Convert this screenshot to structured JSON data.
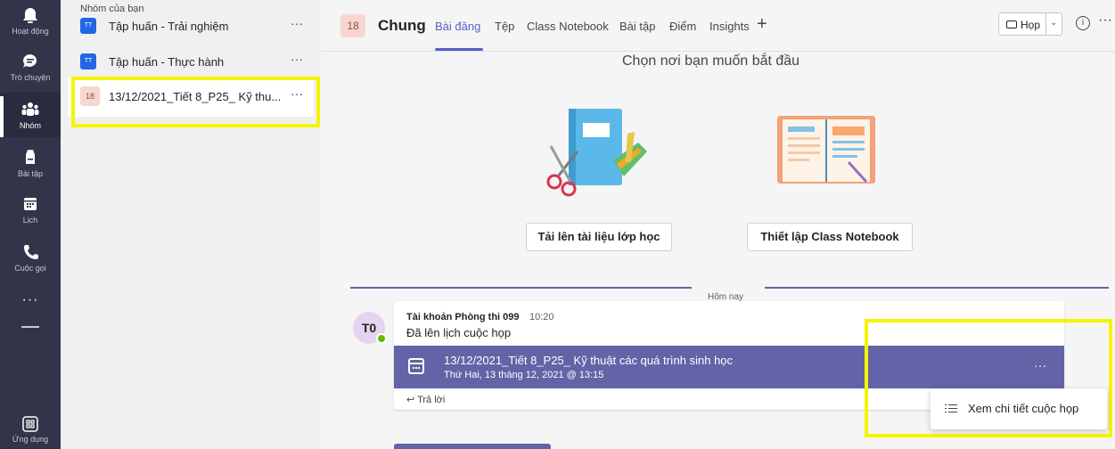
{
  "rail": {
    "items": [
      {
        "label": "Hoạt động"
      },
      {
        "label": "Trò chuyện"
      },
      {
        "label": "Nhóm"
      },
      {
        "label": "Bài tập"
      },
      {
        "label": "Lịch"
      },
      {
        "label": "Cuộc gọi"
      }
    ],
    "more": "···",
    "apps": "Ứng dụng"
  },
  "teams": {
    "header": "Nhóm của bạn",
    "list": [
      {
        "badge": "TT",
        "name": "Tập huấn - Trải nghiệm",
        "more": "···"
      },
      {
        "badge": "TT",
        "name": "Tập huấn - Thực hành",
        "more": "···"
      },
      {
        "badge": "18",
        "name": "13/12/2021_Tiết 8_P25_ Kỹ thu...",
        "more": "···"
      }
    ]
  },
  "channel": {
    "badge": "18",
    "title": "Chung",
    "tabs": [
      "Bài đăng",
      "Tệp",
      "Class Notebook",
      "Bài tập",
      "Điểm",
      "Insights"
    ],
    "plus": "+",
    "meet_label": "Họp",
    "meet_chevron": "⌄",
    "info": "i",
    "more": "···"
  },
  "start": {
    "title": "Chọn nơi bạn muốn bắt đầu",
    "upload_button": "Tải lên tài liệu lớp học",
    "notebook_button": "Thiết lập Class Notebook"
  },
  "feed": {
    "today": "Hôm nay",
    "avatar": "T0",
    "author": "Tài khoản Phòng thi 099",
    "time": "10:20",
    "message": "Đã lên lịch cuộc họp",
    "meeting_title": "13/12/2021_Tiết 8_P25_ Kỹ thuật các quá trình sinh học",
    "meeting_date": "Thứ Hai, 13 tháng 12, 2021 @ 13:15",
    "meeting_more": "···",
    "reply": "Trả lời"
  },
  "context_menu": {
    "item": "Xem chi tiết cuộc họp"
  },
  "colors": {
    "rail_bg": "#33344a",
    "accent": "#6264a7",
    "highlight": "#f5f500"
  }
}
